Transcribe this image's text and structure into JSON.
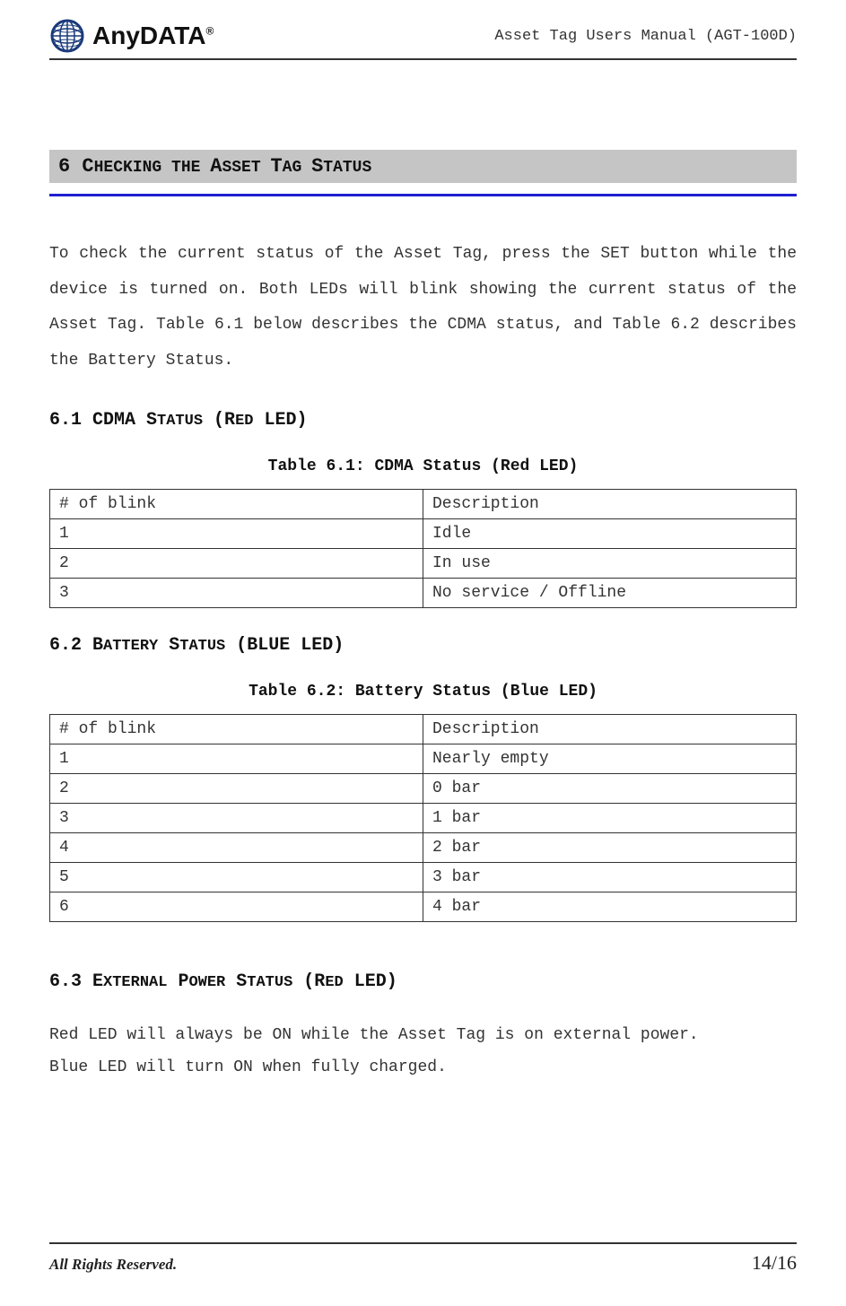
{
  "header": {
    "logo_text": "AnyDATA",
    "logo_r": "®",
    "doc_title": "Asset Tag Users Manual (AGT-100D)"
  },
  "section6": {
    "num": "6 ",
    "title_word1": "C",
    "title_word1b": "HECKING THE ",
    "title_word2": "A",
    "title_word2b": "SSET ",
    "title_word3": "T",
    "title_word3b": "AG ",
    "title_word4": "S",
    "title_word4b": "TATUS",
    "intro": "To check the current status of the Asset Tag, press the SET button while the device is turned on. Both LEDs will blink showing the current status of the Asset Tag. Table 6.1 below describes the CDMA status, and Table 6.2 describes the Battery Status."
  },
  "sub61": {
    "heading": "6.1 CDMA STATUS (RED LED)",
    "caption": "Table 6.1: CDMA Status (Red LED)",
    "headers": {
      "c1": "# of blink",
      "c2": "Description"
    },
    "rows": [
      {
        "c1": "1",
        "c2": "Idle"
      },
      {
        "c1": "2",
        "c2": "In use"
      },
      {
        "c1": "3",
        "c2": "No service / Offline"
      }
    ]
  },
  "sub62": {
    "heading": "6.2 BATTERY STATUS (BLUE LED)",
    "caption": "Table 6.2: Battery Status (Blue LED)",
    "headers": {
      "c1": "# of blink",
      "c2": "Description"
    },
    "rows": [
      {
        "c1": "1",
        "c2": "Nearly empty"
      },
      {
        "c1": "2",
        "c2": "0 bar"
      },
      {
        "c1": "3",
        "c2": "1 bar"
      },
      {
        "c1": "4",
        "c2": "2 bar"
      },
      {
        "c1": "5",
        "c2": "3 bar"
      },
      {
        "c1": "6",
        "c2": "4 bar"
      }
    ]
  },
  "sub63": {
    "heading": "6.3 EXTERNAL POWER STATUS (RED LED)",
    "line1": "Red LED will always be ON while the Asset Tag is on external power.",
    "line2": "Blue LED will turn ON when fully charged."
  },
  "footer": {
    "left": "All Rights Reserved.",
    "right": "14/16"
  }
}
